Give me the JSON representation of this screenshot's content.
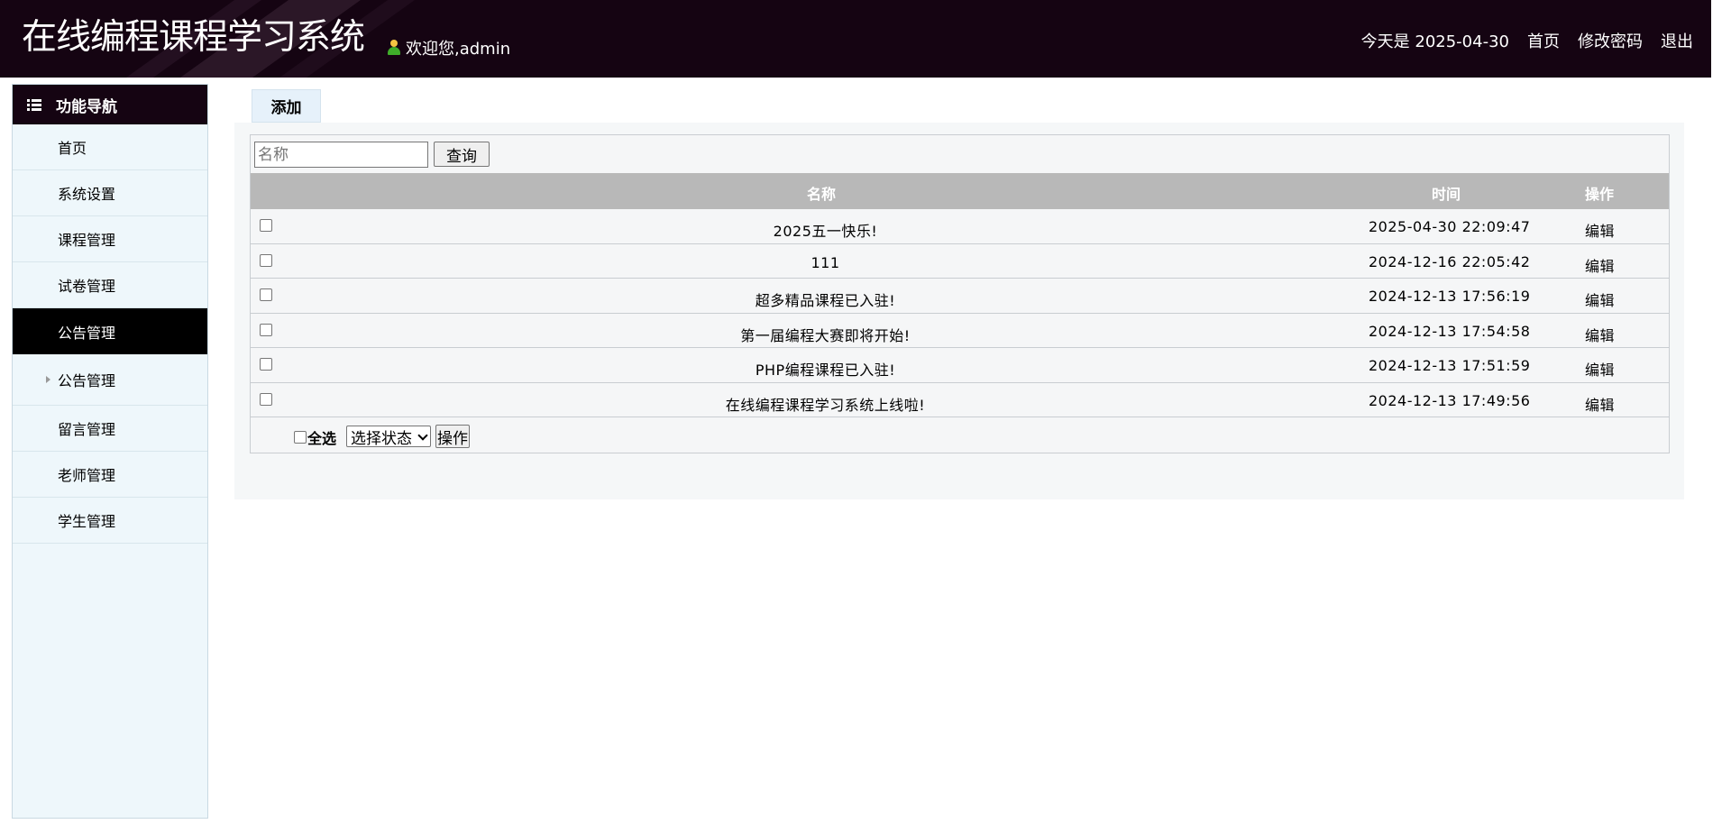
{
  "header": {
    "app_title": "在线编程课程学习系统",
    "welcome_text": "欢迎您,admin",
    "date_text": "今天是 2025-04-30",
    "links": [
      "首页",
      "修改密码",
      "退出"
    ]
  },
  "sidebar": {
    "heading": "功能导航",
    "items": [
      {
        "label": "首页"
      },
      {
        "label": "系统设置"
      },
      {
        "label": "课程管理"
      },
      {
        "label": "试卷管理"
      },
      {
        "label": "公告管理",
        "active": true
      },
      {
        "label": "公告管理",
        "sub": true
      },
      {
        "label": "留言管理"
      },
      {
        "label": "老师管理"
      },
      {
        "label": "学生管理"
      }
    ]
  },
  "main": {
    "tab_label": "添加",
    "search": {
      "placeholder": "名称",
      "value": "",
      "button_label": "查询"
    },
    "table": {
      "columns": [
        "名称",
        "时间",
        "操作"
      ],
      "rows": [
        {
          "name": "2025五一快乐!",
          "time": "2025-04-30 22:09:47",
          "op": "编辑"
        },
        {
          "name": "111",
          "time": "2024-12-16 22:05:42",
          "op": "编辑"
        },
        {
          "name": "超多精品课程已入驻!",
          "time": "2024-12-13 17:56:19",
          "op": "编辑"
        },
        {
          "name": "第一届编程大赛即将开始!",
          "time": "2024-12-13 17:54:58",
          "op": "编辑"
        },
        {
          "name": "PHP编程课程已入驻!",
          "time": "2024-12-13 17:51:59",
          "op": "编辑"
        },
        {
          "name": "在线编程课程学习系统上线啦!",
          "time": "2024-12-13 17:49:56",
          "op": "编辑"
        }
      ]
    },
    "footer": {
      "select_all_label": "全选",
      "status_select": "选择状态",
      "op_button": "操作"
    }
  },
  "colors": {
    "header_bg": "#150412",
    "sidebar_bg": "#eef7fb",
    "active_nav": "#000000",
    "table_head": "#b8b8b8"
  }
}
